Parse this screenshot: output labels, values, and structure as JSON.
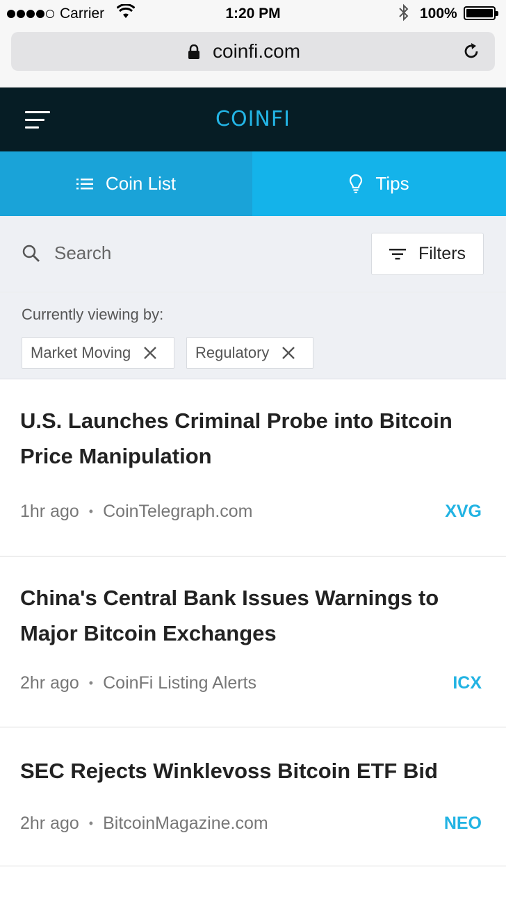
{
  "status_bar": {
    "carrier": "Carrier",
    "time": "1:20 PM",
    "battery": "100%"
  },
  "browser": {
    "url": "coinfi.com"
  },
  "header": {
    "logo": "COINFI"
  },
  "tabs": [
    {
      "label": "Coin List",
      "icon": "list-icon"
    },
    {
      "label": "Tips",
      "icon": "lightbulb-icon"
    }
  ],
  "search": {
    "placeholder": "Search",
    "filters_label": "Filters"
  },
  "viewing": {
    "label": "Currently viewing by:",
    "chips": [
      {
        "label": "Market Moving"
      },
      {
        "label": "Regulatory"
      }
    ]
  },
  "news": [
    {
      "title": "U.S. Launches Criminal Probe into Bitcoin Price Manipulation",
      "time": "1hr ago",
      "source": "CoinTelegraph.com",
      "coin": "XVG"
    },
    {
      "title": "China's Central Bank Issues Warnings to Major Bitcoin Exchanges",
      "time": "2hr ago",
      "source": "CoinFi Listing Alerts",
      "coin": "ICX"
    },
    {
      "title": "SEC Rejects Winklevoss Bitcoin ETF Bid",
      "time": "2hr ago",
      "source": "BitcoinMagazine.com",
      "coin": "NEO"
    }
  ],
  "colors": {
    "header_bg": "#061d25",
    "accent": "#22b3e3",
    "tab_active": "#1aa3d8",
    "tab_inactive": "#14b3ea"
  }
}
